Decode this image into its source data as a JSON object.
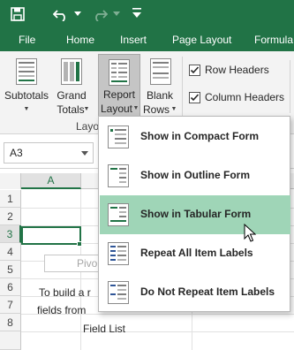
{
  "tabs": [
    "File",
    "Home",
    "Insert",
    "Page Layout",
    "Formula"
  ],
  "ribbon": {
    "subtotals": "Subtotals",
    "grand_totals_line1": "Grand",
    "grand_totals_line2": "Totals",
    "report_layout_line1": "Report",
    "report_layout_line2": "Layout",
    "blank_rows_line1": "Blank",
    "blank_rows_line2": "Rows",
    "group_label": "Layo",
    "row_headers": "Row Headers",
    "column_headers": "Column Headers"
  },
  "namebox": {
    "value": "A3"
  },
  "sheet": {
    "column_a": "A",
    "rows": [
      "1",
      "2",
      "3",
      "4",
      "5",
      "6",
      "7",
      "8"
    ],
    "pivot_text": "Pivo",
    "info_line1": "To build a r",
    "info_line2": "fields from",
    "info_line3": "Field List"
  },
  "menu": {
    "items": [
      {
        "label": "Show in Compact Form"
      },
      {
        "label": "Show in Outline Form"
      },
      {
        "label": "Show in Tabular Form"
      },
      {
        "label": "Repeat All Item Labels"
      },
      {
        "label": "Do Not Repeat Item Labels"
      }
    ]
  },
  "colors": {
    "excel_green": "#217346",
    "selected_item": "#9fd5b7"
  }
}
